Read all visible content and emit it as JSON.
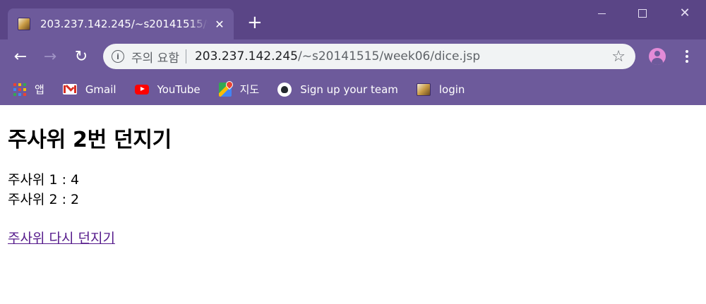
{
  "browser": {
    "tab": {
      "title": "203.237.142.245/~s20141515/week06/dice.jsp",
      "close_glyph": "✕"
    },
    "newtab_glyph": "+",
    "window_controls": {
      "minimize": "–",
      "maximize": "☐",
      "close": "✕"
    },
    "nav": {
      "back_glyph": "←",
      "forward_glyph": "→",
      "reload_glyph": "↻"
    },
    "omnibox": {
      "security_label": "주의 요함",
      "url_host": "203.237.142.245",
      "url_path": "/~s20141515/week06/dice.jsp",
      "info_glyph": "i",
      "star_glyph": "☆"
    },
    "bookmarks": [
      {
        "label": "앱",
        "icon": "apps-grid-icon"
      },
      {
        "label": "Gmail",
        "icon": "gmail-icon"
      },
      {
        "label": "YouTube",
        "icon": "youtube-icon"
      },
      {
        "label": "지도",
        "icon": "maps-icon"
      },
      {
        "label": "Sign up your team",
        "icon": "github-icon"
      },
      {
        "label": "login",
        "icon": "site-favicon-icon"
      }
    ],
    "colors": {
      "frame": "#5f4b8b",
      "toolbar": "#6d5a9b",
      "link_visited": "#551a8b"
    }
  },
  "page": {
    "heading": "주사위 2번 던지기",
    "dice": [
      {
        "text": "주사위 1 : 4"
      },
      {
        "text": "주사위 2 : 2"
      }
    ],
    "reroll_link": "주사위 다시 던지기"
  }
}
